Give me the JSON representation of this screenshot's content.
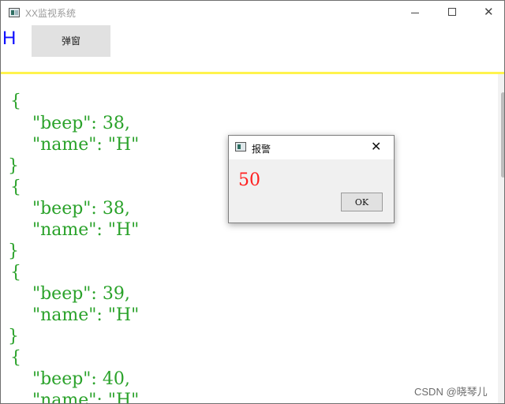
{
  "window": {
    "title": "XX监视系统",
    "controls": {
      "minimize": "minimize",
      "maximize": "maximize",
      "close": "close"
    }
  },
  "header": {
    "label": "H",
    "button_label": "弹窗"
  },
  "content": {
    "lines": [
      "{",
      "    \"beep\": 38,",
      "    \"name\": \"H\"",
      "}",
      "{",
      "    \"beep\": 38,",
      "    \"name\": \"H\"",
      "}",
      "{",
      "    \"beep\": 39,",
      "    \"name\": \"H\"",
      "}",
      "{",
      "    \"beep\": 40,",
      "    \"name\": \"H\""
    ]
  },
  "dialog": {
    "title": "报警",
    "message": "50",
    "ok_label": "OK"
  },
  "watermark": "CSDN @晓琴儿",
  "colors": {
    "json_text": "#2aa22a",
    "accent_line": "#fff34d",
    "header_label": "#1010ff",
    "alert_message": "#ff2020"
  }
}
